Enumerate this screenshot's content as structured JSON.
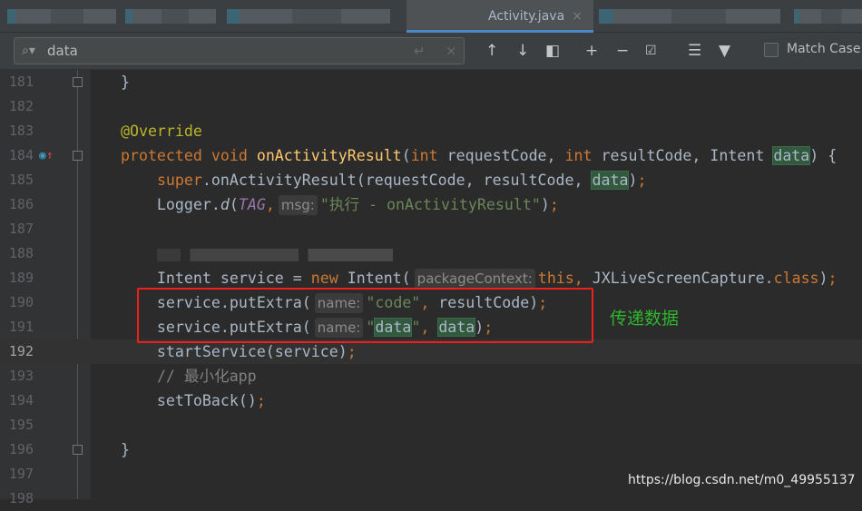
{
  "tabs": {
    "active": "Activity.java",
    "close": "×"
  },
  "search": {
    "value": "data",
    "match_case_label": "Match Case"
  },
  "toolbar_icons": [
    "arrow-up-icon",
    "arrow-down-icon",
    "select-all-icon",
    "add-cursor-icon",
    "remove-cursor-icon",
    "select-occurrences-icon",
    "filter-lines-icon",
    "filter-icon"
  ],
  "code": [
    {
      "n": "181",
      "t": [
        [
          "txt",
          "    }"
        ]
      ],
      "fold": true
    },
    {
      "n": "182",
      "t": []
    },
    {
      "n": "183",
      "t": [
        [
          "txt",
          "    "
        ],
        [
          "ann",
          "@Override"
        ]
      ]
    },
    {
      "n": "184",
      "t": [
        [
          "txt",
          "    "
        ],
        [
          "kw",
          "protected void "
        ],
        [
          "fn",
          "onActivityResult"
        ],
        [
          "txt",
          "("
        ],
        [
          "kw",
          "int "
        ],
        [
          "txt",
          "requestCode, "
        ],
        [
          "kw",
          "int "
        ],
        [
          "txt",
          "resultCode, Intent "
        ],
        [
          "hl",
          "data"
        ],
        [
          "txt",
          ") {"
        ]
      ],
      "fold": true,
      "icon": true
    },
    {
      "n": "185",
      "t": [
        [
          "txt",
          "        "
        ],
        [
          "kw",
          "super"
        ],
        [
          "txt",
          ".onActivityResult(requestCode, resultCode, "
        ],
        [
          "hl",
          "data"
        ],
        [
          "txt",
          ")"
        ],
        [
          "kw",
          ";"
        ]
      ]
    },
    {
      "n": "186",
      "t": [
        [
          "txt",
          "        Logger."
        ],
        [
          "it",
          "d"
        ],
        [
          "txt",
          "("
        ],
        [
          "tag",
          "TAG"
        ],
        [
          "kw",
          ","
        ],
        [
          "hint",
          "msg:"
        ],
        [
          "str",
          "\"执行 - onActivityResult\""
        ],
        [
          "txt",
          ")"
        ],
        [
          "kw",
          ";"
        ]
      ]
    },
    {
      "n": "187",
      "t": []
    },
    {
      "n": "188",
      "t": [
        [
          "txt",
          "        "
        ],
        [
          "blur",
          ""
        ]
      ]
    },
    {
      "n": "189",
      "t": [
        [
          "txt",
          "        Intent service = "
        ],
        [
          "kw",
          "new "
        ],
        [
          "txt",
          "Intent("
        ],
        [
          "hint",
          "packageContext:"
        ],
        [
          "kw",
          "this, "
        ],
        [
          "txt",
          "JXLiveScreenCapture."
        ],
        [
          "kw",
          "class"
        ],
        [
          "txt",
          ")"
        ],
        [
          "kw",
          ";"
        ]
      ]
    },
    {
      "n": "190",
      "t": [
        [
          "txt",
          "        service.putExtra("
        ],
        [
          "hint",
          "name:"
        ],
        [
          "str",
          "\"code\""
        ],
        [
          "kw",
          ", "
        ],
        [
          "txt",
          "resultCode)"
        ],
        [
          "kw",
          ";"
        ]
      ]
    },
    {
      "n": "191",
      "t": [
        [
          "txt",
          "        service.putExtra("
        ],
        [
          "hint",
          "name:"
        ],
        [
          "str",
          "\""
        ],
        [
          "hl",
          "data"
        ],
        [
          "str",
          "\""
        ],
        [
          "kw",
          ", "
        ],
        [
          "hl",
          "data"
        ],
        [
          "txt",
          ")"
        ],
        [
          "kw",
          ";"
        ]
      ]
    },
    {
      "n": "192",
      "t": [
        [
          "txt",
          "        startService(service)"
        ],
        [
          "kw",
          ";"
        ]
      ],
      "cur": true
    },
    {
      "n": "193",
      "t": [
        [
          "txt",
          "        "
        ],
        [
          "cmt",
          "// 最小化app"
        ]
      ]
    },
    {
      "n": "194",
      "t": [
        [
          "txt",
          "        setToBack()"
        ],
        [
          "kw",
          ";"
        ]
      ]
    },
    {
      "n": "195",
      "t": []
    },
    {
      "n": "196",
      "t": [
        [
          "txt",
          "    }"
        ]
      ],
      "fold": true
    },
    {
      "n": "197",
      "t": []
    },
    {
      "n": "198",
      "t": []
    }
  ],
  "annotation": {
    "note": "传递数据",
    "color": "#f01e1e"
  },
  "watermark": "https://blog.csdn.net/m0_49955137"
}
